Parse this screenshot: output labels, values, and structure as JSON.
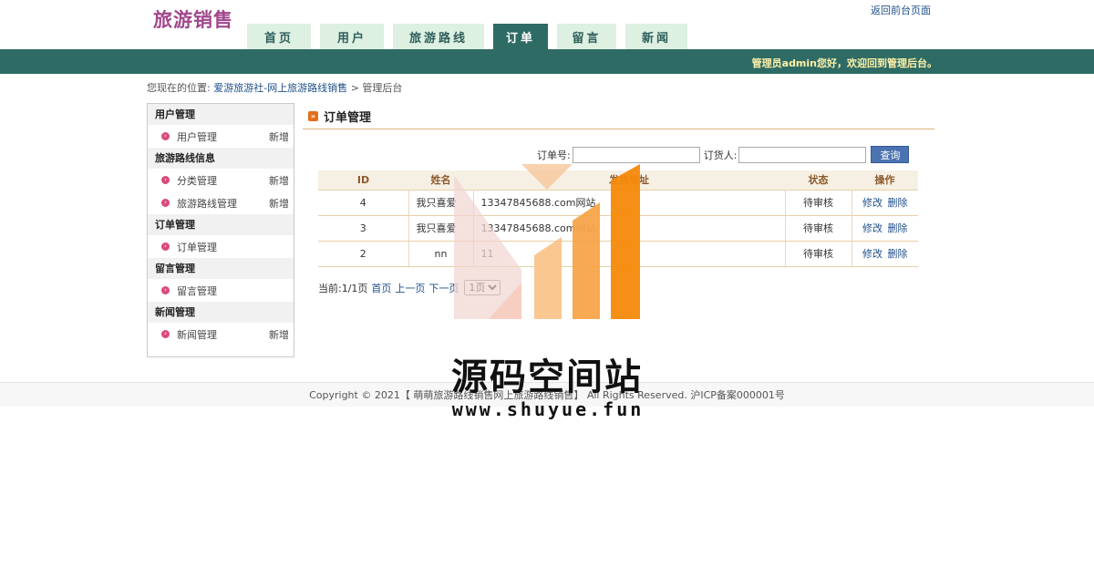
{
  "header": {
    "logo": "旅游销售",
    "back_link": "返回前台页面",
    "welcome": "管理员admin您好，欢迎回到管理后台。",
    "nav": [
      {
        "label": "首页",
        "active": false
      },
      {
        "label": "用户",
        "active": false
      },
      {
        "label": "旅游路线",
        "active": false
      },
      {
        "label": "订单",
        "active": true
      },
      {
        "label": "留言",
        "active": false
      },
      {
        "label": "新闻",
        "active": false
      }
    ]
  },
  "breadcrumb": {
    "prefix": "您现在的位置:",
    "link": "爱游旅游社-网上旅游路线销售",
    "separator": ">",
    "current": "管理后台"
  },
  "sidebar": {
    "groups": [
      {
        "title": "用户管理",
        "items": [
          {
            "label": "用户管理",
            "add": "新增"
          }
        ]
      },
      {
        "title": "旅游路线信息",
        "items": [
          {
            "label": "分类管理",
            "add": "新增"
          },
          {
            "label": "旅游路线管理",
            "add": "新增"
          }
        ]
      },
      {
        "title": "订单管理",
        "items": [
          {
            "label": "订单管理",
            "add": ""
          }
        ]
      },
      {
        "title": "留言管理",
        "items": [
          {
            "label": "留言管理",
            "add": ""
          }
        ]
      },
      {
        "title": "新闻管理",
        "items": [
          {
            "label": "新闻管理",
            "add": "新增"
          }
        ]
      }
    ]
  },
  "content": {
    "title": "订单管理",
    "search": {
      "order_no_label": "订单号:",
      "order_no_value": "",
      "customer_label": "订货人:",
      "customer_value": "",
      "button": "查询"
    },
    "table": {
      "headers": [
        "ID",
        "姓名",
        "发货地址",
        "状态",
        "操作"
      ],
      "rows": [
        {
          "id": "4",
          "name": "我只喜爱",
          "address": "13347845688.com网站",
          "status": "待审核",
          "edit": "修改",
          "delete": "删除"
        },
        {
          "id": "3",
          "name": "我只喜爱",
          "address": "13347845688.com网站",
          "status": "待审核",
          "edit": "修改",
          "delete": "删除"
        },
        {
          "id": "2",
          "name": "nn",
          "address": "11",
          "status": "待审核",
          "edit": "修改",
          "delete": "删除"
        }
      ]
    },
    "pager": {
      "info": "当前:1/1页",
      "first": "首页",
      "prev": "上一页",
      "next": "下一页",
      "selected": "1页"
    }
  },
  "footer": {
    "text": "Copyright © 2021【 萌萌旅游路线销售网上旅游路线销售】 All Rights Reserved. 沪ICP备案000001号"
  },
  "watermark": {
    "title": "源码空间站",
    "url": "www.shuyue.fun"
  },
  "colors": {
    "brand": "#a0478c",
    "bar": "#2f6b65",
    "nav_tab": "#ddf0e2",
    "link": "#1f4f8a",
    "accent": "#e2701c"
  }
}
